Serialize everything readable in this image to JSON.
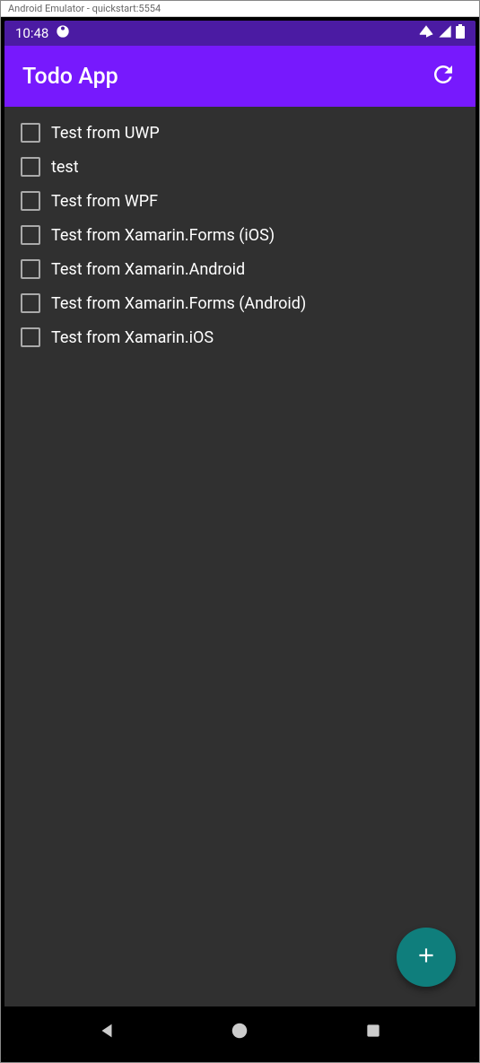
{
  "window": {
    "title": "Android Emulator - quickstart:5554"
  },
  "status_bar": {
    "time": "10:48"
  },
  "app_bar": {
    "title": "Todo App"
  },
  "todos": [
    {
      "label": "Test from UWP",
      "checked": false
    },
    {
      "label": "test",
      "checked": false
    },
    {
      "label": "Test from WPF",
      "checked": false
    },
    {
      "label": "Test from Xamarin.Forms (iOS)",
      "checked": false
    },
    {
      "label": "Test from Xamarin.Android",
      "checked": false
    },
    {
      "label": "Test from Xamarin.Forms (Android)",
      "checked": false
    },
    {
      "label": "Test from Xamarin.iOS",
      "checked": false
    }
  ]
}
